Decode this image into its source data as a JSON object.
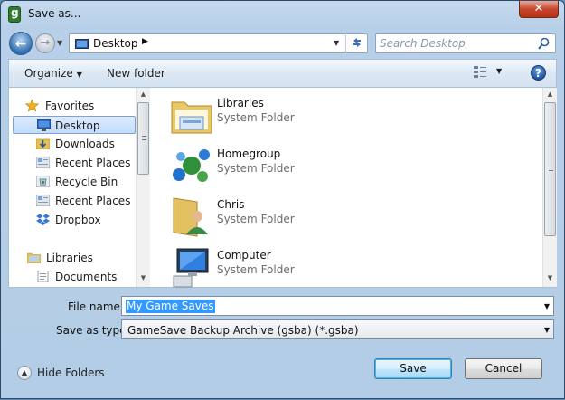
{
  "window": {
    "title": "Save as...",
    "close_label": "✕"
  },
  "nav": {
    "back_glyph": "←",
    "forward_glyph": "→",
    "address": "Desktop",
    "search_placeholder": "Search Desktop"
  },
  "toolbar": {
    "organize_label": "Organize",
    "new_folder_label": "New folder",
    "help_label": "?"
  },
  "sidebar": {
    "items": [
      {
        "label": "Favorites",
        "icon": "star-icon"
      },
      {
        "label": "Desktop",
        "icon": "desktop-icon"
      },
      {
        "label": "Downloads",
        "icon": "downloads-icon"
      },
      {
        "label": "Recent Places",
        "icon": "recent-places-icon"
      },
      {
        "label": "Recycle Bin",
        "icon": "recycle-bin-icon"
      },
      {
        "label": "Recent Places",
        "icon": "recent-places-icon"
      },
      {
        "label": "Dropbox",
        "icon": "dropbox-icon"
      },
      {
        "label": "Libraries",
        "icon": "libraries-icon"
      },
      {
        "label": "Documents",
        "icon": "documents-icon"
      }
    ]
  },
  "files": [
    {
      "name": "Libraries",
      "type": "System Folder",
      "icon": "libraries-folder-icon"
    },
    {
      "name": "Homegroup",
      "type": "System Folder",
      "icon": "homegroup-icon"
    },
    {
      "name": "Chris",
      "type": "System Folder",
      "icon": "user-folder-icon"
    },
    {
      "name": "Computer",
      "type": "System Folder",
      "icon": "computer-icon"
    }
  ],
  "form": {
    "filename_label": "File name:",
    "filename_value": "My Game Saves",
    "type_label": "Save as type:",
    "type_value": "GameSave Backup Archive (gsba) (*.gsba)"
  },
  "footer": {
    "hide_folders_label": "Hide Folders",
    "save_label": "Save",
    "cancel_label": "Cancel"
  }
}
